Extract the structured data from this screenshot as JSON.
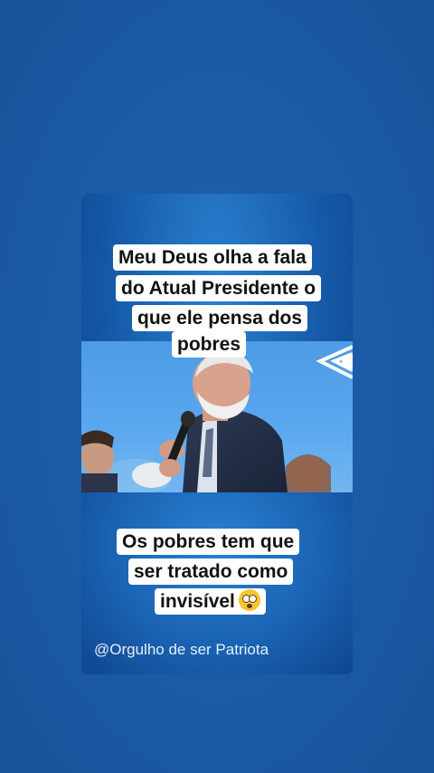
{
  "post": {
    "caption_top_lines": [
      "Meu Deus olha a fala",
      "do Atual Presidente o",
      "que ele pensa dos",
      "pobres"
    ],
    "caption_bottom_lines": [
      "Os pobres tem que",
      "ser tratado como",
      "invisível"
    ],
    "emoji": "flushed-face-icon",
    "watermark": "@Orgulho de ser Patriota"
  },
  "colors": {
    "background": "#1b5aa4",
    "card": "#155aa8",
    "caption_bg": "#ffffff",
    "caption_text": "#111111"
  }
}
